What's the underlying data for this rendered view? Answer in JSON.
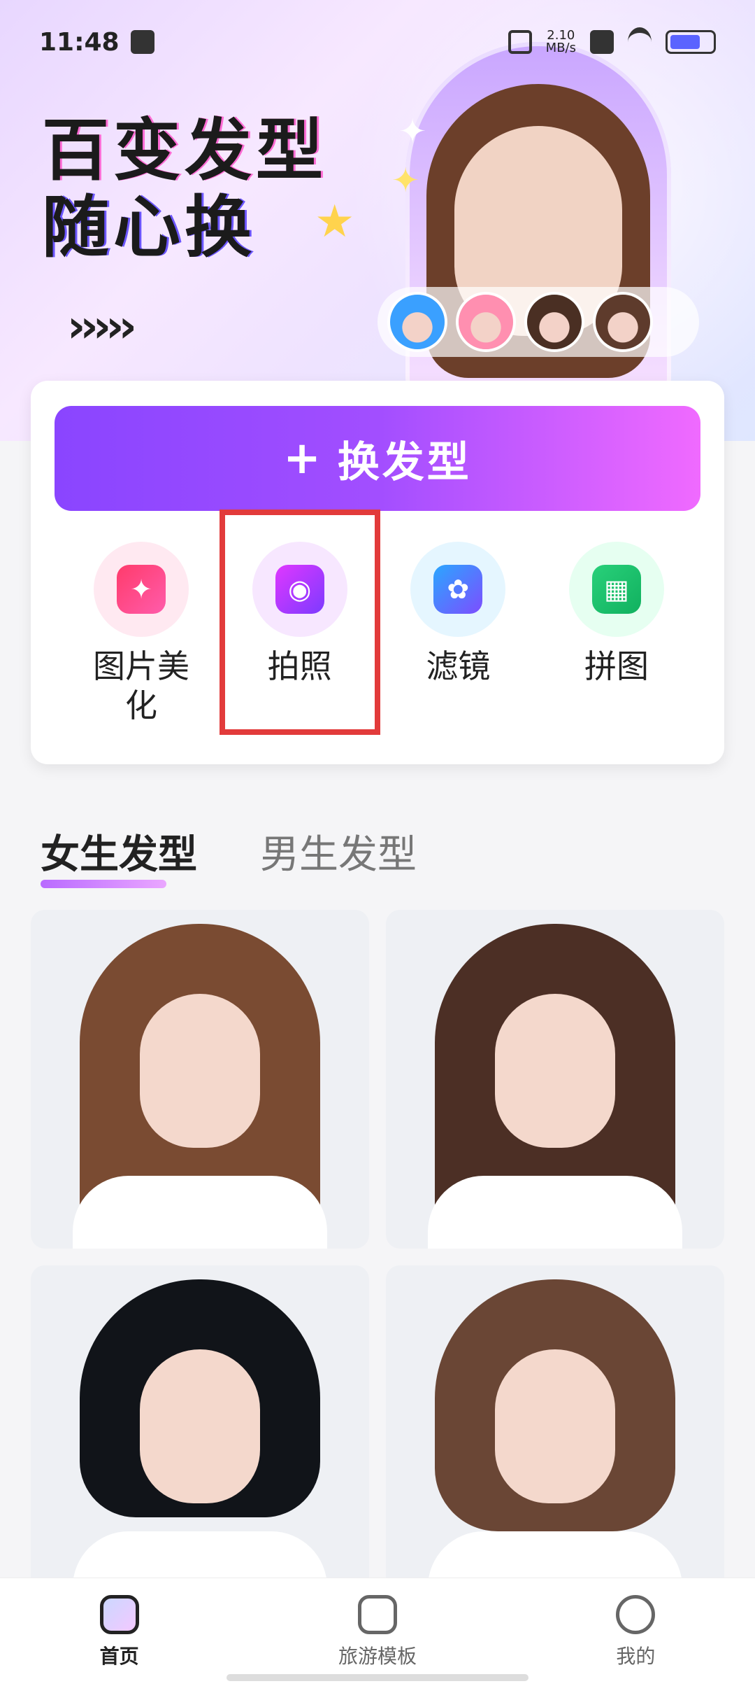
{
  "status_bar": {
    "time": "11:48",
    "speed_value": "2.10",
    "speed_unit": "MB/s"
  },
  "banner": {
    "title_line1": "百变发型",
    "title_line2": "随心换",
    "arrows": "›››››"
  },
  "card": {
    "main_button_label": "换发型",
    "tools": [
      {
        "label": "图片美化",
        "icon": "magic-wand-icon"
      },
      {
        "label": "拍照",
        "icon": "camera-icon"
      },
      {
        "label": "滤镜",
        "icon": "filter-icon"
      },
      {
        "label": "拼图",
        "icon": "collage-icon"
      }
    ]
  },
  "tabs": [
    {
      "label": "女生发型",
      "active": true
    },
    {
      "label": "男生发型",
      "active": false
    }
  ],
  "bottom_nav": [
    {
      "label": "首页",
      "icon": "home-icon",
      "active": true
    },
    {
      "label": "旅游模板",
      "icon": "template-icon",
      "active": false
    },
    {
      "label": "我的",
      "icon": "profile-icon",
      "active": false
    }
  ],
  "colors": {
    "accent_gradient_start": "#8a45ff",
    "accent_gradient_end": "#f06aff",
    "highlight_box": "#e23b3b"
  }
}
